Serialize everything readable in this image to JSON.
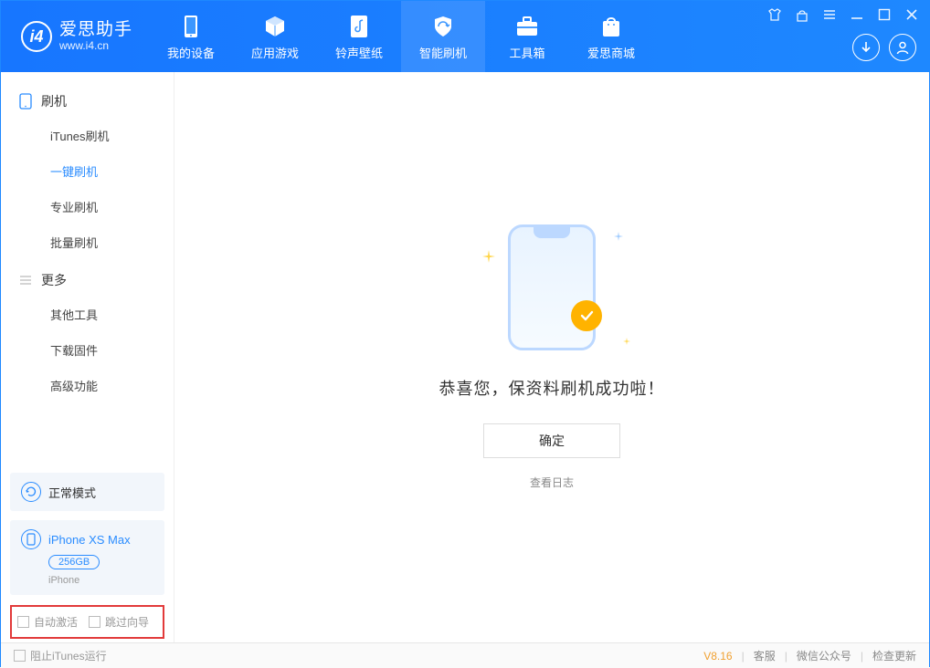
{
  "app": {
    "name": "爱思助手",
    "url": "www.i4.cn"
  },
  "tabs": [
    {
      "label": "我的设备",
      "icon": "phone"
    },
    {
      "label": "应用游戏",
      "icon": "cube"
    },
    {
      "label": "铃声壁纸",
      "icon": "music"
    },
    {
      "label": "智能刷机",
      "icon": "shield"
    },
    {
      "label": "工具箱",
      "icon": "toolbox"
    },
    {
      "label": "爱思商城",
      "icon": "bag"
    }
  ],
  "active_tab_index": 3,
  "sidebar": {
    "sections": [
      {
        "title": "刷机",
        "items": [
          "iTunes刷机",
          "一键刷机",
          "专业刷机",
          "批量刷机"
        ],
        "active_index": 1
      },
      {
        "title": "更多",
        "items": [
          "其他工具",
          "下载固件",
          "高级功能"
        ],
        "active_index": -1
      }
    ],
    "mode": {
      "label": "正常模式"
    },
    "device": {
      "name": "iPhone XS Max",
      "capacity": "256GB",
      "line": "iPhone"
    },
    "options": {
      "auto_activate": "自动激活",
      "skip_setup": "跳过向导"
    }
  },
  "main": {
    "success_text": "恭喜您，保资料刷机成功啦！",
    "ok_button": "确定",
    "view_log": "查看日志"
  },
  "status": {
    "block_itunes": "阻止iTunes运行",
    "version": "V8.16",
    "links": [
      "客服",
      "微信公众号",
      "检查更新"
    ]
  }
}
